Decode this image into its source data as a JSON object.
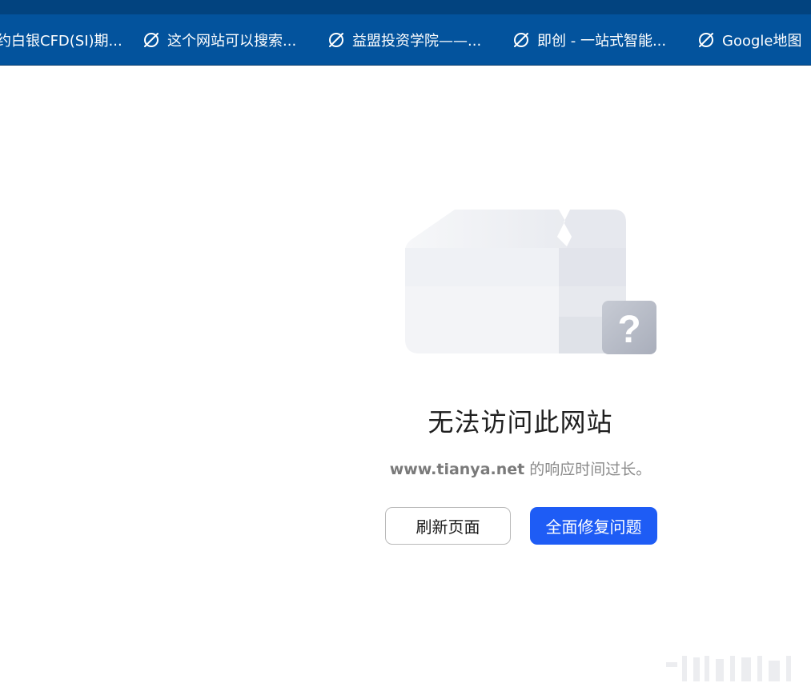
{
  "bookmarks": [
    {
      "label": "约白银CFD(SI)期...",
      "icon": "globe-slash-icon"
    },
    {
      "label": "这个网站可以搜索...",
      "icon": "globe-slash-icon"
    },
    {
      "label": "益盟投资学院——...",
      "icon": "globe-slash-icon"
    },
    {
      "label": "即创 - 一站式智能...",
      "icon": "globe-slash-icon"
    },
    {
      "label": "Google地图",
      "icon": "globe-slash-icon"
    }
  ],
  "error": {
    "title": "无法访问此网站",
    "host": "www.tianya.net",
    "message": " 的响应时间过长。",
    "illustration_icon": "broken-box-question-icon"
  },
  "buttons": {
    "refresh": "刷新页面",
    "repair": "全面修复问题"
  },
  "colors": {
    "bookmark_bar": "#03539d",
    "primary_button": "#1e5cf5",
    "title_text": "#1f1f1f",
    "desc_text": "#8a8a8a"
  }
}
